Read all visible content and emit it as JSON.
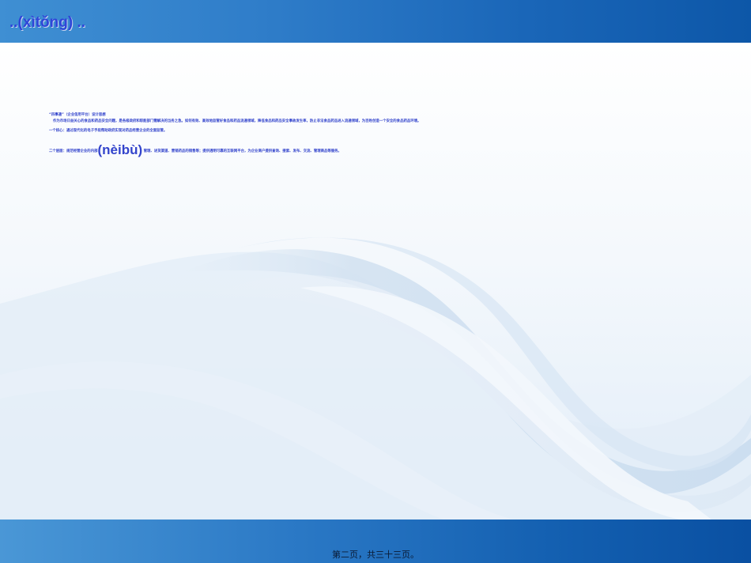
{
  "slide": {
    "title": "..(xìtǒng) ..",
    "footer": "第二页，共三十三页。"
  },
  "content": {
    "line1": "“四事通”（企业信用平台）设计思想",
    "line2": "作为市场日益关心的食品和药品安全问题，是各级政府和职能部门需解决的当务之急。如何有效、高效地监管好食品和药品流通领域，降低食品和药品安全事故发生率，防止非法食品药品进入流通领域，为百姓创造一个安全的食品药品环境。",
    "line3": "一个核心：通过现代化的电子手段帮助政府实现对药品经营企业的全面监管。",
    "line4_pre": "二个层面：规范经营企业的内部",
    "line4_big": "(nèibù)",
    "line4_post": " 管理、进货渠道、营销药品的销售等；提供透明可靠的互联网平台，为企业商户提供查询、搜索、发布、交流、管理商品等服务。"
  }
}
